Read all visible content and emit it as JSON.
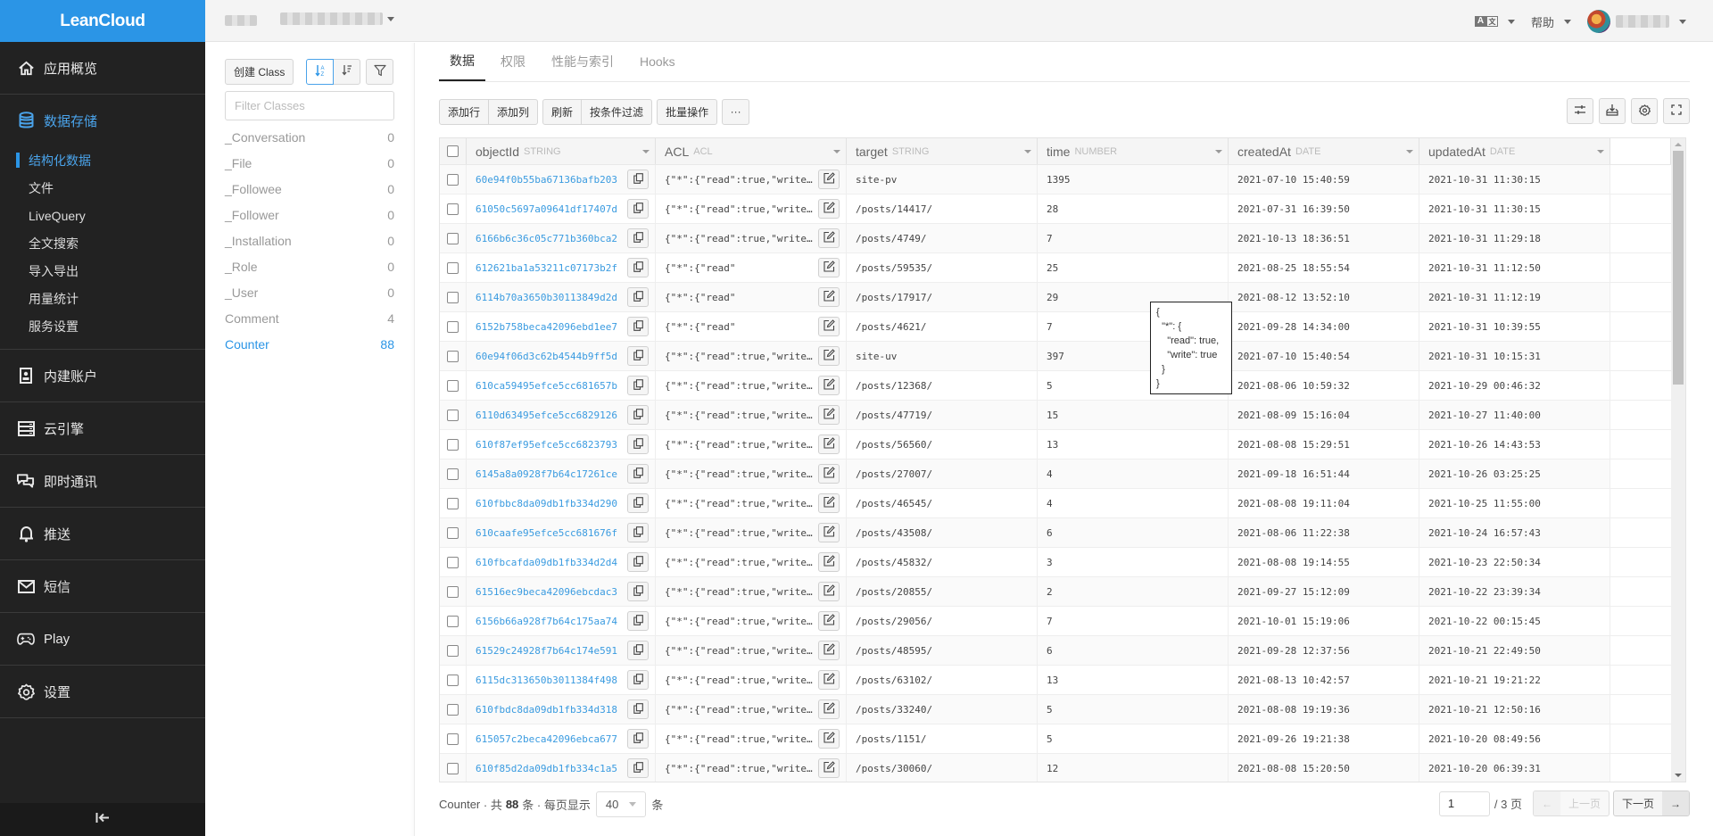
{
  "brand": "LeanCloud",
  "topbar": {
    "help_label": "帮助",
    "language_icon": "translate-icon"
  },
  "nav": {
    "items": [
      {
        "label": "应用概览",
        "icon": "home-icon"
      },
      {
        "label": "数据存储",
        "icon": "database-icon",
        "active": true,
        "children": [
          {
            "label": "结构化数据",
            "active": true
          },
          {
            "label": "文件"
          },
          {
            "label": "LiveQuery"
          },
          {
            "label": "全文搜索"
          },
          {
            "label": "导入导出"
          },
          {
            "label": "用量统计"
          },
          {
            "label": "服务设置"
          }
        ]
      },
      {
        "label": "内建账户",
        "icon": "user-card-icon"
      },
      {
        "label": "云引擎",
        "icon": "server-icon"
      },
      {
        "label": "即时通讯",
        "icon": "chat-icon"
      },
      {
        "label": "推送",
        "icon": "bell-icon"
      },
      {
        "label": "短信",
        "icon": "mail-icon"
      },
      {
        "label": "Play",
        "icon": "gamepad-icon"
      },
      {
        "label": "设置",
        "icon": "gear-icon"
      }
    ],
    "collapse_icon": "collapse-left-icon"
  },
  "classes": {
    "create_label": "创建 Class",
    "filter_placeholder": "Filter Classes",
    "items": [
      {
        "name": "_Conversation",
        "count": "0"
      },
      {
        "name": "_File",
        "count": "0"
      },
      {
        "name": "_Followee",
        "count": "0"
      },
      {
        "name": "_Follower",
        "count": "0"
      },
      {
        "name": "_Installation",
        "count": "0"
      },
      {
        "name": "_Role",
        "count": "0"
      },
      {
        "name": "_User",
        "count": "0"
      },
      {
        "name": "Comment",
        "count": "4"
      },
      {
        "name": "Counter",
        "count": "88",
        "active": true
      }
    ]
  },
  "tabs": [
    {
      "label": "数据",
      "active": true
    },
    {
      "label": "权限"
    },
    {
      "label": "性能与索引"
    },
    {
      "label": "Hooks"
    }
  ],
  "toolbar": {
    "add_row": "添加行",
    "add_column": "添加列",
    "refresh": "刷新",
    "filter": "按条件过滤",
    "batch": "批量操作",
    "more": "···"
  },
  "table": {
    "columns": [
      {
        "name": "objectId",
        "type": "STRING"
      },
      {
        "name": "ACL",
        "type": "ACL"
      },
      {
        "name": "target",
        "type": "STRING"
      },
      {
        "name": "time",
        "type": "NUMBER"
      },
      {
        "name": "createdAt",
        "type": "DATE"
      },
      {
        "name": "updatedAt",
        "type": "DATE"
      }
    ],
    "acl_value": "{\"*\":{\"read\":true,\"write\"…",
    "acl_short": "{\"*\":{\"read\"",
    "rows": [
      {
        "objectId": "60e94f0b55ba67136bafb203",
        "target": "site-pv",
        "time": "1395",
        "createdAt": "2021-07-10 15:40:59",
        "updatedAt": "2021-10-31 11:30:15"
      },
      {
        "objectId": "61050c5697a09641df17407d",
        "target": "/posts/14417/",
        "time": "28",
        "createdAt": "2021-07-31 16:39:50",
        "updatedAt": "2021-10-31 11:30:15"
      },
      {
        "objectId": "6166b6c36c05c771b360bca2",
        "target": "/posts/4749/",
        "time": "7",
        "createdAt": "2021-10-13 18:36:51",
        "updatedAt": "2021-10-31 11:29:18"
      },
      {
        "objectId": "612621ba1a53211c07173b2f",
        "target": "/posts/59535/",
        "time": "25",
        "createdAt": "2021-08-25 18:55:54",
        "updatedAt": "2021-10-31 11:12:50"
      },
      {
        "objectId": "6114b70a3650b30113849d2d",
        "target": "/posts/17917/",
        "time": "29",
        "createdAt": "2021-08-12 13:52:10",
        "updatedAt": "2021-10-31 11:12:19"
      },
      {
        "objectId": "6152b758beca42096ebd1ee7",
        "target": "/posts/4621/",
        "time": "7",
        "createdAt": "2021-09-28 14:34:00",
        "updatedAt": "2021-10-31 10:39:55"
      },
      {
        "objectId": "60e94f06d3c62b4544b9ff5d",
        "target": "site-uv",
        "time": "397",
        "createdAt": "2021-07-10 15:40:54",
        "updatedAt": "2021-10-31 10:15:31"
      },
      {
        "objectId": "610ca59495efce5cc681657b",
        "target": "/posts/12368/",
        "time": "5",
        "createdAt": "2021-08-06 10:59:32",
        "updatedAt": "2021-10-29 00:46:32"
      },
      {
        "objectId": "6110d63495efce5cc6829126",
        "target": "/posts/47719/",
        "time": "15",
        "createdAt": "2021-08-09 15:16:04",
        "updatedAt": "2021-10-27 11:40:00"
      },
      {
        "objectId": "610f87ef95efce5cc6823793",
        "target": "/posts/56560/",
        "time": "13",
        "createdAt": "2021-08-08 15:29:51",
        "updatedAt": "2021-10-26 14:43:53"
      },
      {
        "objectId": "6145a8a0928f7b64c17261ce",
        "target": "/posts/27007/",
        "time": "4",
        "createdAt": "2021-09-18 16:51:44",
        "updatedAt": "2021-10-26 03:25:25"
      },
      {
        "objectId": "610fbbc8da09db1fb334d290",
        "target": "/posts/46545/",
        "time": "4",
        "createdAt": "2021-08-08 19:11:04",
        "updatedAt": "2021-10-25 11:55:00"
      },
      {
        "objectId": "610caafe95efce5cc681676f",
        "target": "/posts/43508/",
        "time": "6",
        "createdAt": "2021-08-06 11:22:38",
        "updatedAt": "2021-10-24 16:57:43"
      },
      {
        "objectId": "610fbcafda09db1fb334d2d4",
        "target": "/posts/45832/",
        "time": "3",
        "createdAt": "2021-08-08 19:14:55",
        "updatedAt": "2021-10-23 22:50:34"
      },
      {
        "objectId": "61516ec9beca42096ebcdac3",
        "target": "/posts/20855/",
        "time": "2",
        "createdAt": "2021-09-27 15:12:09",
        "updatedAt": "2021-10-22 23:39:34"
      },
      {
        "objectId": "6156b66a928f7b64c175aa74",
        "target": "/posts/29056/",
        "time": "7",
        "createdAt": "2021-10-01 15:19:06",
        "updatedAt": "2021-10-22 00:15:45"
      },
      {
        "objectId": "61529c24928f7b64c174e591",
        "target": "/posts/48595/",
        "time": "6",
        "createdAt": "2021-09-28 12:37:56",
        "updatedAt": "2021-10-21 22:49:50"
      },
      {
        "objectId": "6115dc313650b3011384f498",
        "target": "/posts/63102/",
        "time": "13",
        "createdAt": "2021-08-13 10:42:57",
        "updatedAt": "2021-10-21 19:21:22"
      },
      {
        "objectId": "610fbdc8da09db1fb334d318",
        "target": "/posts/33240/",
        "time": "5",
        "createdAt": "2021-08-08 19:19:36",
        "updatedAt": "2021-10-21 12:50:16"
      },
      {
        "objectId": "615057c2beca42096ebca677",
        "target": "/posts/1151/",
        "time": "5",
        "createdAt": "2021-09-26 19:21:38",
        "updatedAt": "2021-10-20 08:49:56"
      },
      {
        "objectId": "610f85d2da09db1fb334c1a5",
        "target": "/posts/30060/",
        "time": "12",
        "createdAt": "2021-08-08 15:20:50",
        "updatedAt": "2021-10-20 06:39:31"
      }
    ],
    "tooltip_text": "{\n  \"*\": {\n    \"read\": true,\n    \"write\": true\n  }\n}"
  },
  "footer": {
    "class_name": "Counter",
    "total_prefix": "· 共",
    "total": "88",
    "total_suffix": "条 · 每页显示",
    "page_size": "40",
    "page_size_suffix": "条",
    "current_page": "1",
    "total_pages_label": "/ 3 页",
    "prev_label": "上一页",
    "next_label": "下一页"
  }
}
